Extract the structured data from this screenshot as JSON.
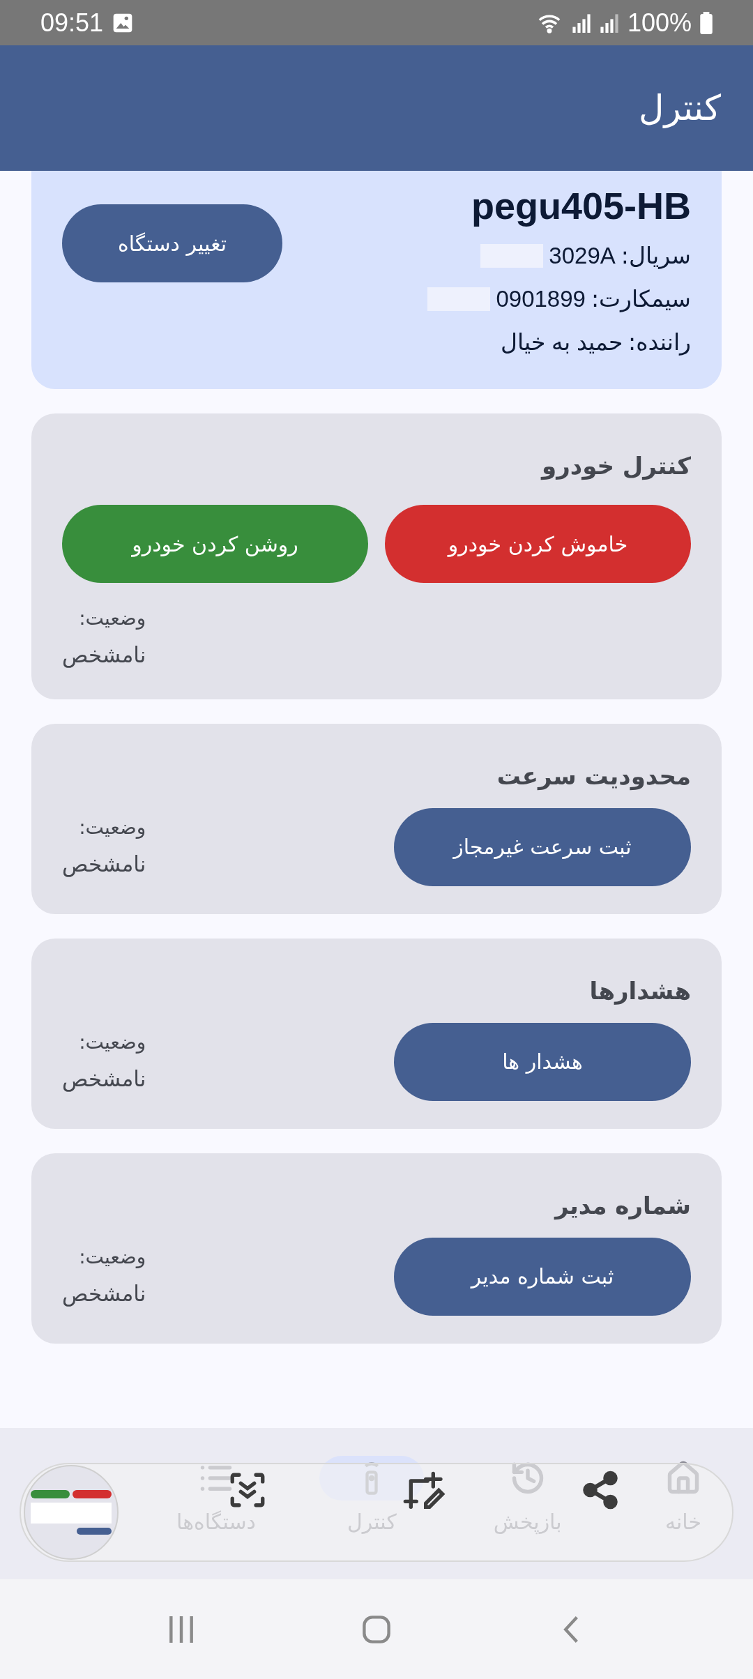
{
  "status_bar": {
    "time": "09:51",
    "battery": "100%"
  },
  "app_bar": {
    "title": "کنترل"
  },
  "device": {
    "name": "pegu405-HB",
    "fields": [
      {
        "label": "سریال:",
        "value": "3029A"
      },
      {
        "label": "سیمکارت:",
        "value": "0901899"
      },
      {
        "label": "راننده:",
        "value": "حمید به خیال"
      }
    ],
    "button": "تغییر دستگاه"
  },
  "cards": [
    {
      "kind": "pair",
      "title": "کنترل خودرو",
      "buttons": [
        {
          "label": "خاموش کردن خودرو",
          "color": "#d32f2f"
        },
        {
          "label": "روشن کردن خودرو",
          "color": "#388e3c"
        }
      ],
      "status_label": "وضعیت:",
      "status_value": "نامشخص"
    },
    {
      "kind": "single",
      "title": "محدودیت سرعت",
      "buttons": [
        {
          "label": "ثبت سرعت غیرمجاز",
          "color": "#455f91"
        }
      ],
      "status_label": "وضعیت:",
      "status_value": "نامشخص"
    },
    {
      "kind": "single",
      "title": "هشدارها",
      "buttons": [
        {
          "label": "هشدار ها",
          "color": "#455f91"
        }
      ],
      "status_label": "وضعیت:",
      "status_value": "نامشخص"
    },
    {
      "kind": "single",
      "title": "شماره مدیر",
      "buttons": [
        {
          "label": "ثبت شماره مدیر",
          "color": "#455f91"
        }
      ],
      "status_label": "وضعیت:",
      "status_value": "نامشخص"
    }
  ],
  "bottom_nav": [
    {
      "kind": "home",
      "label": "خانه",
      "selected": false
    },
    {
      "kind": "history",
      "label": "بازپخش",
      "selected": false
    },
    {
      "kind": "remote",
      "label": "کنترل",
      "selected": true
    },
    {
      "kind": "list",
      "label": "دستگاه‌ها",
      "selected": false
    }
  ]
}
